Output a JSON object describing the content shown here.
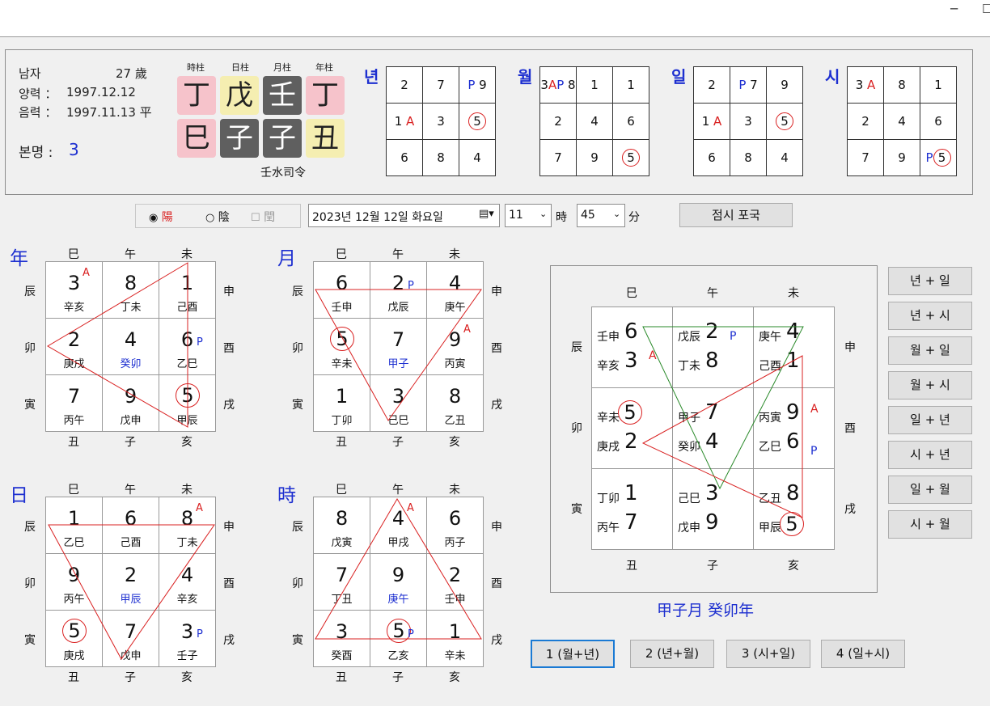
{
  "window": {
    "minimize": "─",
    "maximize": "☐"
  },
  "info": {
    "gender": "남자",
    "age": "27 歲",
    "solar_label": "양력 ：",
    "solar_date": "1997.12.12",
    "lunar_label": "음력 ：",
    "lunar_date": "1997.11.13 平",
    "bonmyeong_label": "본명 :",
    "bonmyeong_value": "3"
  },
  "pillars": {
    "labels": [
      "時柱",
      "日柱",
      "月柱",
      "年柱"
    ],
    "stems": [
      "丁",
      "戊",
      "壬",
      "丁"
    ],
    "branches": [
      "巳",
      "子",
      "子",
      "丑"
    ],
    "siryeong": "壬水司令"
  },
  "mini_grids": [
    {
      "label": "년",
      "cells": [
        {
          "p": "",
          "t": "2"
        },
        {
          "p": "",
          "t": "7"
        },
        {
          "p": "P",
          "t": "9"
        },
        {
          "t": "1",
          "a": "A"
        },
        {
          "t": "3"
        },
        {
          "t": "5",
          "c": 1
        },
        {
          "t": "6"
        },
        {
          "t": "8"
        },
        {
          "t": "4"
        }
      ]
    },
    {
      "label": "월",
      "cells": [
        {
          "t": "3",
          "a": "A",
          "p": "P",
          "t2": "8"
        },
        {
          "t": "1"
        },
        {
          "t": "2"
        },
        {
          "t": "4"
        },
        {
          "t": "6"
        },
        {
          "t": "7"
        },
        {
          "t": "9"
        },
        {
          "t": "5",
          "c": 1
        }
      ]
    },
    {
      "label": "일",
      "cells": [
        {
          "t": "2"
        },
        {
          "t": "7",
          "p": "P"
        },
        {
          "t": "9"
        },
        {
          "t": "1",
          "a": "A"
        },
        {
          "t": "3"
        },
        {
          "t": "5",
          "c": 1
        },
        {
          "t": "6"
        },
        {
          "t": "8"
        },
        {
          "t": "4"
        }
      ]
    },
    {
      "label": "시",
      "cells": [
        {
          "t": "3",
          "a": "A"
        },
        {
          "t": "8"
        },
        {
          "t": "1"
        },
        {
          "t": "2"
        },
        {
          "t": "4"
        },
        {
          "t": "6"
        },
        {
          "t": "7"
        },
        {
          "t": "9"
        },
        {
          "t": "5",
          "c": 1,
          "p": "P"
        }
      ]
    }
  ],
  "controls": {
    "yang": "陽",
    "eum": "陰",
    "yun": "閏",
    "date": "2023년 12월 12일 화요일",
    "hour": "11",
    "hour_unit": "時",
    "minute": "45",
    "minute_unit": "分",
    "jeomsi_button": "점시 포국"
  },
  "branch_labels": {
    "top": [
      "巳",
      "午",
      "未"
    ],
    "bottom": [
      "丑",
      "子",
      "亥"
    ],
    "left": [
      "辰",
      "卯",
      "寅"
    ],
    "right": [
      "申",
      "酉",
      "戌"
    ]
  },
  "boards": [
    {
      "head": "年",
      "cells": [
        {
          "n": "3",
          "s": "辛亥",
          "a": "A"
        },
        {
          "n": "8",
          "s": "丁未"
        },
        {
          "n": "1",
          "s": "己酉"
        },
        {
          "n": "2",
          "s": "庚戌"
        },
        {
          "n": "4",
          "s": "癸卯",
          "blue": 1
        },
        {
          "n": "6",
          "s": "乙巳",
          "p": "P"
        },
        {
          "n": "7",
          "s": "丙午"
        },
        {
          "n": "9",
          "s": "戊申"
        },
        {
          "n": "5",
          "s": "甲辰",
          "c": 1
        }
      ]
    },
    {
      "head": "月",
      "cells": [
        {
          "n": "6",
          "s": "壬申"
        },
        {
          "n": "2",
          "s": "戊辰",
          "p": "P"
        },
        {
          "n": "4",
          "s": "庚午"
        },
        {
          "n": "5",
          "s": "辛未",
          "c": 1
        },
        {
          "n": "7",
          "s": "甲子",
          "blue": 1
        },
        {
          "n": "9",
          "s": "丙寅",
          "a": "A"
        },
        {
          "n": "1",
          "s": "丁卯"
        },
        {
          "n": "3",
          "s": "己巳"
        },
        {
          "n": "8",
          "s": "乙丑"
        }
      ]
    },
    {
      "head": "日",
      "cells": [
        {
          "n": "1",
          "s": "乙巳"
        },
        {
          "n": "6",
          "s": "己酉"
        },
        {
          "n": "8",
          "s": "丁未",
          "a": "A"
        },
        {
          "n": "9",
          "s": "丙午"
        },
        {
          "n": "2",
          "s": "甲辰",
          "blue": 1
        },
        {
          "n": "4",
          "s": "辛亥"
        },
        {
          "n": "5",
          "s": "庚戌",
          "c": 1
        },
        {
          "n": "7",
          "s": "戊申"
        },
        {
          "n": "3",
          "s": "壬子",
          "p": "P"
        }
      ]
    },
    {
      "head": "時",
      "cells": [
        {
          "n": "8",
          "s": "戊寅"
        },
        {
          "n": "4",
          "s": "甲戌",
          "a": "A"
        },
        {
          "n": "6",
          "s": "丙子"
        },
        {
          "n": "7",
          "s": "丁丑"
        },
        {
          "n": "9",
          "s": "庚午",
          "blue": 1
        },
        {
          "n": "2",
          "s": "壬申"
        },
        {
          "n": "3",
          "s": "癸酉"
        },
        {
          "n": "5",
          "s": "乙亥",
          "c": 1,
          "p": "P"
        },
        {
          "n": "1",
          "s": "辛未"
        }
      ]
    }
  ],
  "combined": {
    "cells": [
      {
        "r1l": "壬申",
        "r1n": "6",
        "r2l": "辛亥",
        "r2n": "3",
        "a": "A"
      },
      {
        "r1l": "戊辰",
        "r1n": "2",
        "r2l": "丁未",
        "r2n": "8",
        "p": "P"
      },
      {
        "r1l": "庚午",
        "r1n": "4",
        "r2l": "己酉",
        "r2n": "1"
      },
      {
        "r1l": "辛未",
        "r1n": "5",
        "r2l": "庚戌",
        "r2n": "2",
        "c1": 1
      },
      {
        "r1l": "甲子",
        "r1n": "7",
        "r2l": "癸卯",
        "r2n": "4"
      },
      {
        "r1l": "丙寅",
        "r1n": "9",
        "r2l": "乙巳",
        "r2n": "6",
        "a": "A",
        "p": "P"
      },
      {
        "r1l": "丁卯",
        "r1n": "1",
        "r2l": "丙午",
        "r2n": "7"
      },
      {
        "r1l": "己巳",
        "r1n": "3",
        "r2l": "戊申",
        "r2n": "9"
      },
      {
        "r1l": "乙丑",
        "r1n": "8",
        "r2l": "甲辰",
        "r2n": "5",
        "c2": 1
      }
    ],
    "caption": "甲子月  癸卯年"
  },
  "side_buttons": [
    "년 + 일",
    "년 + 시",
    "월 + 일",
    "월 + 시",
    "일 + 년",
    "시 + 년",
    "일 + 월",
    "시 + 월"
  ],
  "bottom_buttons": [
    "1 (월+년)",
    "2 (년+월)",
    "3 (시+일)",
    "4 (일+시)"
  ]
}
